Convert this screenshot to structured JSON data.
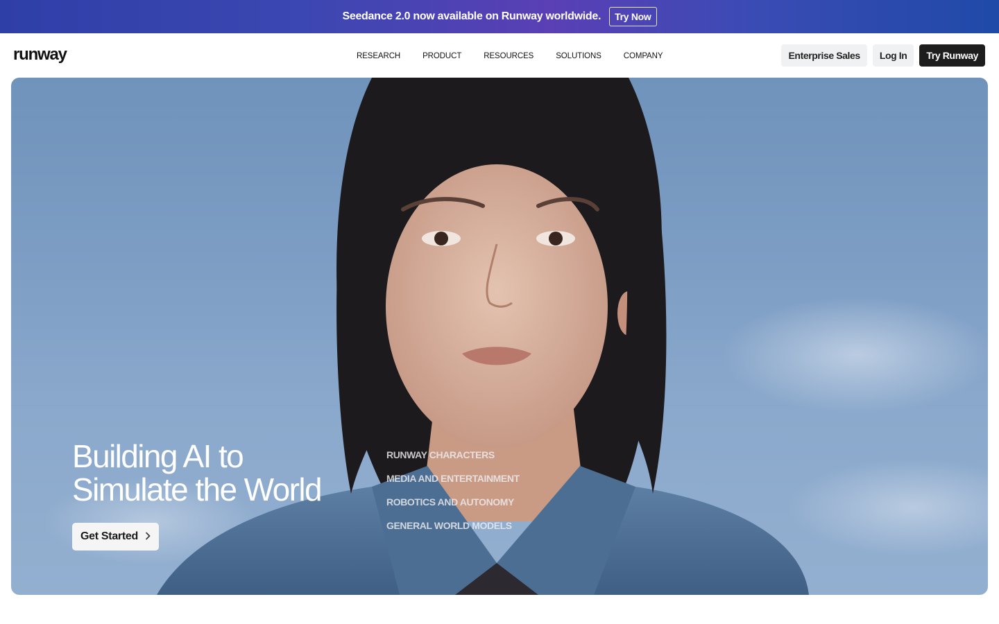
{
  "banner": {
    "text": "Seedance 2.0 now available on Runway worldwide.",
    "button": "Try Now"
  },
  "header": {
    "logo": "runway",
    "nav": [
      "RESEARCH",
      "PRODUCT",
      "RESOURCES",
      "SOLUTIONS",
      "COMPANY"
    ],
    "enterprise": "Enterprise Sales",
    "login": "Log In",
    "try": "Try Runway"
  },
  "hero": {
    "title_line1": "Building AI to",
    "title_line2": "Simulate the World",
    "cta": "Get Started",
    "cta_icon": "chevron-right-icon",
    "categories": [
      "RUNWAY CHARACTERS",
      "MEDIA AND ENTERTAINMENT",
      "ROBOTICS AND AUTONOMY",
      "GENERAL WORLD MODELS"
    ]
  },
  "colors": {
    "banner_start": "#2f3fa8",
    "banner_mid": "#5a3fb5",
    "sky": "#7d9dc4",
    "dark_button": "#1d1d1d",
    "light_button": "#f0f1f2"
  }
}
